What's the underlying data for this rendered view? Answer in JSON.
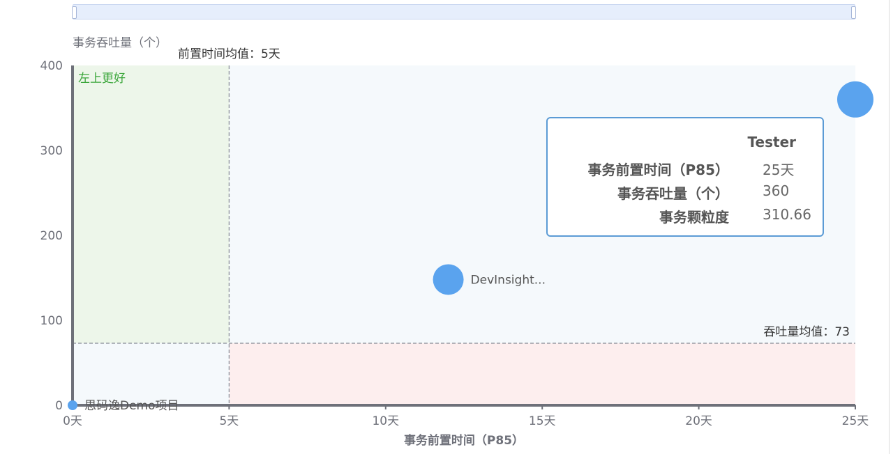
{
  "chart_data": {
    "type": "scatter",
    "xlabel": "事务前置时间（P85）",
    "ylabel": "事务吞吐量（个）",
    "xlim": [
      0,
      25
    ],
    "ylim": [
      0,
      400
    ],
    "x_ticks": [
      "0天",
      "5天",
      "10天",
      "15天",
      "20天",
      "25天"
    ],
    "y_ticks": [
      "0",
      "100",
      "200",
      "300",
      "400"
    ],
    "grid": false,
    "mean_x_label": "前置时间均值：5天",
    "mean_x": 5,
    "mean_y_label": "吞吐量均值：73",
    "mean_y": 73,
    "quadrant_note": "左上更好",
    "points": [
      {
        "name": "思码逸Demo项目",
        "label": "思码逸Demo项目",
        "x": 0,
        "y": 0,
        "size": "small"
      },
      {
        "name": "DevInsight",
        "label": "DevInsight...",
        "x": 12,
        "y": 148,
        "size": "medium"
      },
      {
        "name": "Tester",
        "label": "",
        "x": 25,
        "y": 360,
        "size": "large",
        "granularity": "310.66"
      }
    ],
    "colors": {
      "point": "#5aa3ee",
      "upper_left": "#edf6ea",
      "lower_right": "#fdeeee",
      "plot_bg": "#f5f9fc",
      "axis": "#6e7079"
    }
  },
  "tooltip": {
    "title": "Tester",
    "rows": [
      {
        "key": "事务前置时间（P85）",
        "value": "25天"
      },
      {
        "key": "事务吞吐量（个）",
        "value": "360"
      },
      {
        "key": "事务颗粒度",
        "value": "310.66"
      }
    ]
  }
}
